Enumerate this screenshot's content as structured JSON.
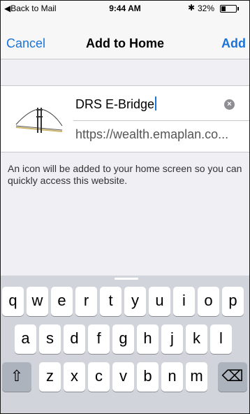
{
  "status_bar": {
    "back_label": "◀Back to Mail",
    "time": "9:44 AM",
    "bluetooth_icon": "bluetooth-icon",
    "battery_percent": "32%",
    "battery_level": 0.32
  },
  "nav": {
    "cancel_label": "Cancel",
    "title": "Add to Home",
    "add_label": "Add"
  },
  "form": {
    "name_value": "DRS E-Bridge",
    "url_value": "https://wealth.emaplan.co...",
    "clear_icon": "clear-text-icon",
    "site_icon": "bridge-icon"
  },
  "note": "An icon will be added to your home screen so you can quickly access this website.",
  "keyboard": {
    "row1": [
      "q",
      "w",
      "e",
      "r",
      "t",
      "y",
      "u",
      "i",
      "o",
      "p"
    ],
    "row2": [
      "a",
      "s",
      "d",
      "f",
      "g",
      "h",
      "j",
      "k",
      "l"
    ],
    "row3": [
      "z",
      "x",
      "c",
      "v",
      "b",
      "n",
      "m"
    ],
    "shift_icon": "shift-icon",
    "delete_icon": "delete-icon"
  },
  "colors": {
    "accent": "#1a73d9",
    "background": "#efeff4",
    "keyboard": "#d1d5db"
  }
}
